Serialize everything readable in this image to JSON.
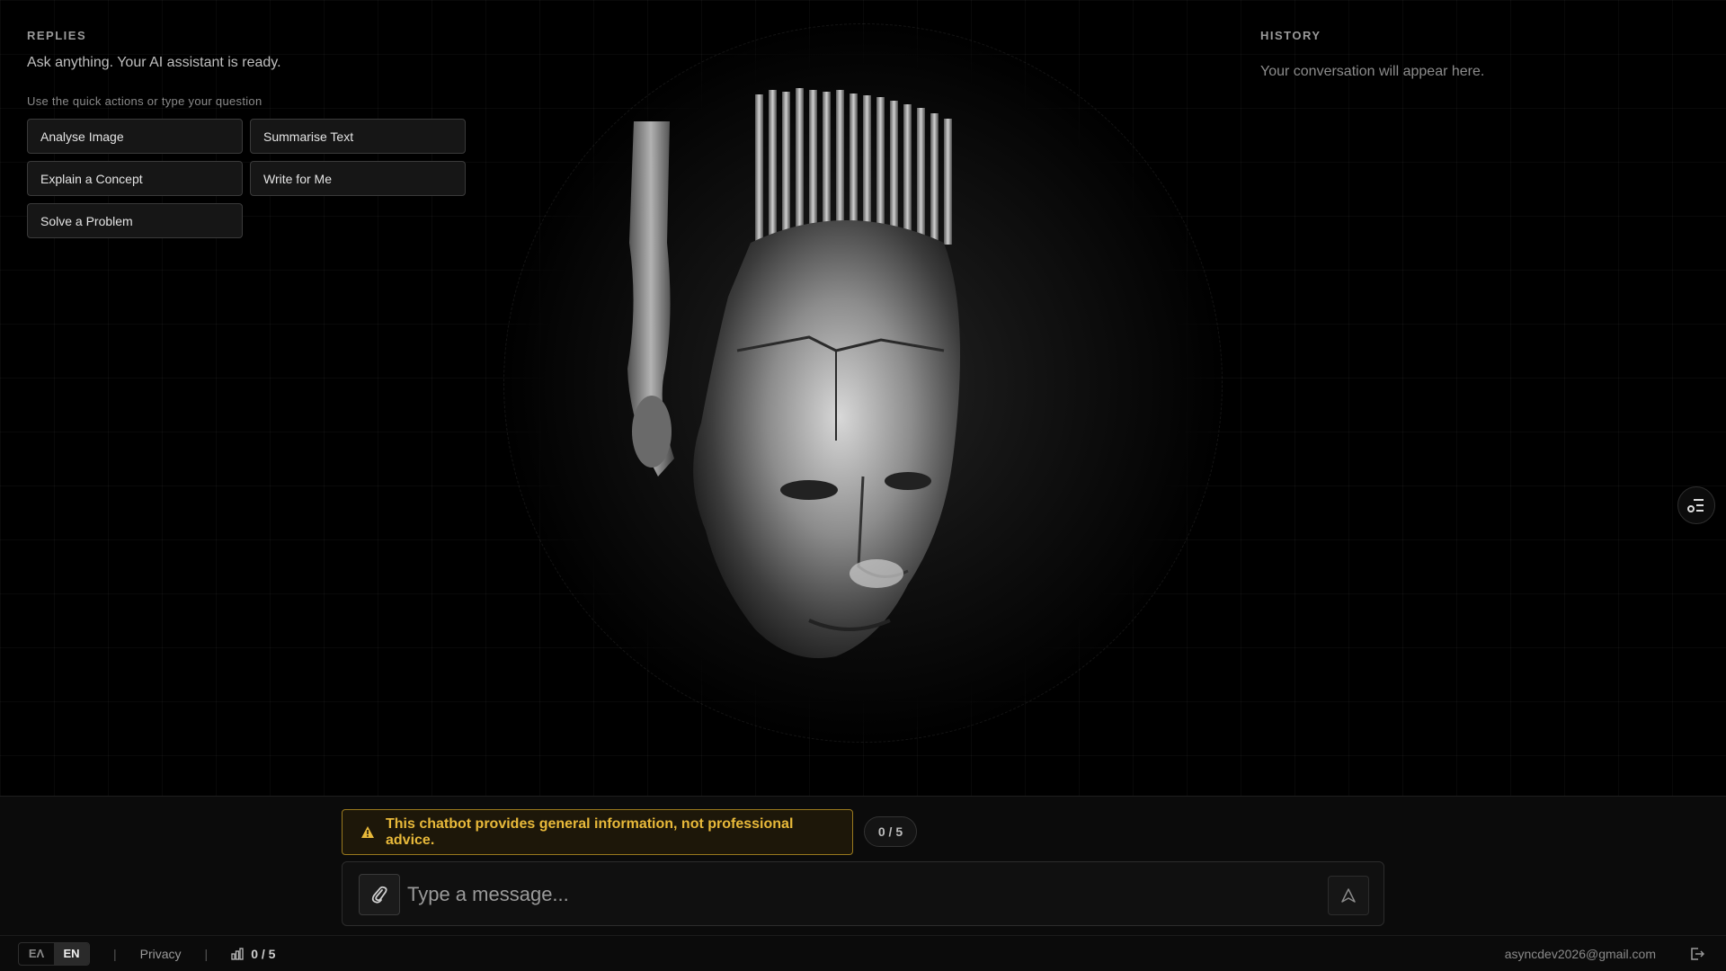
{
  "replies": {
    "title": "REPLIES",
    "subtitle": "Ask anything. Your AI assistant is ready.",
    "hint": "Use the quick actions or type your question",
    "quick_actions": [
      {
        "label": "Analyse Image"
      },
      {
        "label": "Summarise Text"
      },
      {
        "label": "Explain a Concept"
      },
      {
        "label": "Write for Me"
      },
      {
        "label": "Solve a Problem"
      }
    ]
  },
  "history": {
    "title": "HISTORY",
    "empty": "Your conversation will appear here."
  },
  "disclaimer": {
    "text": "This chatbot provides general information, not professional advice."
  },
  "counter": "0 / 5",
  "composer": {
    "placeholder": "Type a message..."
  },
  "footer": {
    "lang_el": "ΕΛ",
    "lang_en": "EN",
    "privacy": "Privacy",
    "usage": "0 / 5",
    "email": "asyncdev2026@gmail.com"
  },
  "icons": {
    "attach": "paperclip-icon",
    "send": "send-icon",
    "warning": "warning-icon",
    "side_toggle": "panel-toggle-icon",
    "usage": "bar-chart-icon",
    "logout": "logout-icon"
  },
  "colors": {
    "background": "#000000",
    "warning": "#e8b93a",
    "warning_border": "#9a7a1e"
  }
}
